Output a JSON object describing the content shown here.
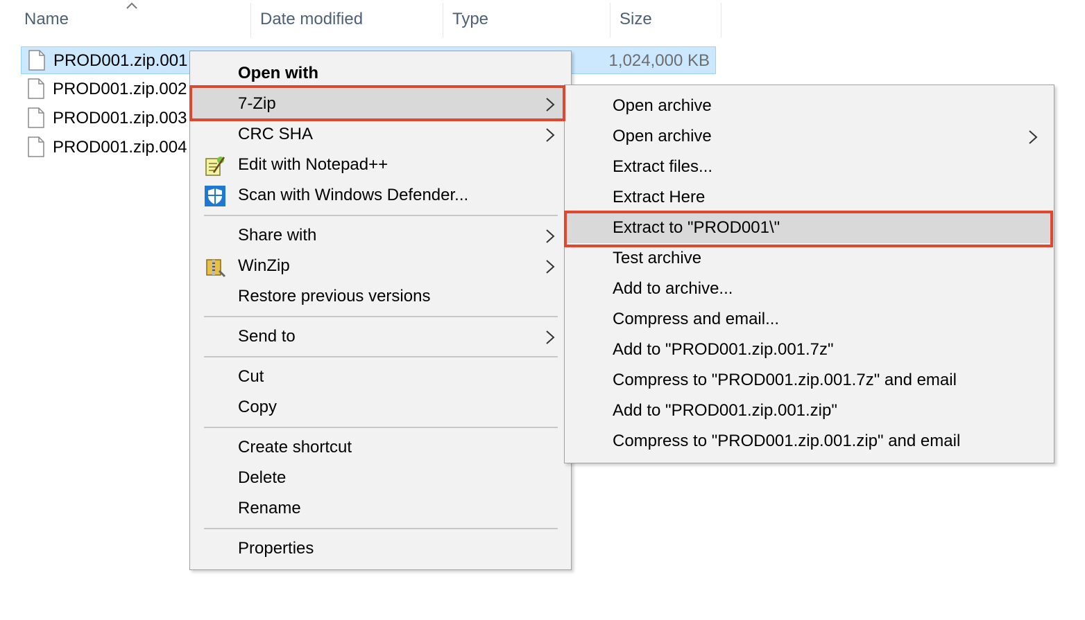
{
  "columns": {
    "name": "Name",
    "date_modified": "Date modified",
    "type": "Type",
    "size": "Size"
  },
  "files": [
    {
      "name": "PROD001.zip.001",
      "size": "1,024,000 KB",
      "selected": true
    },
    {
      "name": "PROD001.zip.002"
    },
    {
      "name": "PROD001.zip.003"
    },
    {
      "name": "PROD001.zip.004"
    }
  ],
  "context_menu": {
    "open_with": "Open with",
    "seven_zip": "7-Zip",
    "crc_sha": "CRC SHA",
    "edit_notepad": "Edit with Notepad++",
    "scan_defender": "Scan with Windows Defender...",
    "share_with": "Share with",
    "winzip": "WinZip",
    "restore_previous": "Restore previous versions",
    "send_to": "Send to",
    "cut": "Cut",
    "copy": "Copy",
    "create_shortcut": "Create shortcut",
    "delete": "Delete",
    "rename": "Rename",
    "properties": "Properties"
  },
  "submenu_7zip": {
    "items": [
      "Open archive",
      "Open archive",
      "Extract files...",
      "Extract Here",
      "Extract to \"PROD001\\\"",
      "Test archive",
      "Add to archive...",
      "Compress and email...",
      "Add to \"PROD001.zip.001.7z\"",
      "Compress to \"PROD001.zip.001.7z\" and email",
      "Add to \"PROD001.zip.001.zip\"",
      "Compress to \"PROD001.zip.001.zip\" and email"
    ]
  },
  "colors": {
    "selection_bg": "#cce8ff",
    "menu_bg": "#f2f2f2",
    "hover_bg": "#d9d9d9",
    "highlight_box": "#e0472e"
  }
}
